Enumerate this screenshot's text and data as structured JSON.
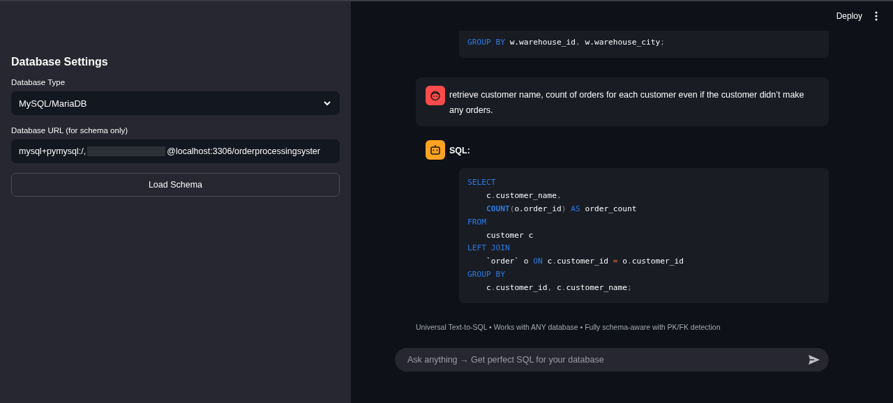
{
  "sidebar": {
    "title": "Database Settings",
    "db_type": {
      "label": "Database Type",
      "value": "MySQL/MariaDB"
    },
    "db_url": {
      "label": "Database URL (for schema only)",
      "value_before": "mysql+pymysql:/,",
      "redacted": true,
      "value_after": "@localhost:3306/orderprocessingsyster"
    },
    "load_button": "Load Schema"
  },
  "header": {
    "deploy": "Deploy"
  },
  "messages": [
    {
      "kind": "continuation",
      "code": [
        [
          {
            "kind": "kw",
            "text": "GROUP BY"
          },
          {
            "kind": "plain",
            "text": " w.warehouse_id"
          },
          {
            "kind": "punct",
            "text": ","
          },
          {
            "kind": "plain",
            "text": " w.warehouse_city"
          },
          {
            "kind": "punct",
            "text": ";"
          }
        ]
      ]
    },
    {
      "kind": "user",
      "text": "retrieve customer name, count of orders for each customer even if the customer didn’t make any orders."
    },
    {
      "kind": "assistant",
      "text": "SQL:",
      "code": [
        [
          {
            "kind": "kw",
            "text": "SELECT"
          }
        ],
        [
          {
            "kind": "plain",
            "text": "    c"
          },
          {
            "kind": "punct",
            "text": "."
          },
          {
            "kind": "plain",
            "text": "customer_name"
          },
          {
            "kind": "punct",
            "text": ","
          }
        ],
        [
          {
            "kind": "fn",
            "text": "    COUNT"
          },
          {
            "kind": "punct",
            "text": "("
          },
          {
            "kind": "plain",
            "text": "o.order_id"
          },
          {
            "kind": "punct",
            "text": ")"
          },
          {
            "kind": "kw",
            "text": " AS"
          },
          {
            "kind": "plain",
            "text": " order_count"
          }
        ],
        [
          {
            "kind": "kw",
            "text": "FROM"
          }
        ],
        [
          {
            "kind": "plain",
            "text": "    customer c"
          }
        ],
        [
          {
            "kind": "kw",
            "text": "LEFT JOIN"
          }
        ],
        [
          {
            "kind": "plain",
            "text": "    `order` o "
          },
          {
            "kind": "kw",
            "text": "ON"
          },
          {
            "kind": "plain",
            "text": " c"
          },
          {
            "kind": "punct",
            "text": "."
          },
          {
            "kind": "plain",
            "text": "customer_id "
          },
          {
            "kind": "op",
            "text": "="
          },
          {
            "kind": "plain",
            "text": " o"
          },
          {
            "kind": "punct",
            "text": "."
          },
          {
            "kind": "plain",
            "text": "customer_id"
          }
        ],
        [
          {
            "kind": "kw",
            "text": "GROUP BY"
          }
        ],
        [
          {
            "kind": "plain",
            "text": "    c"
          },
          {
            "kind": "punct",
            "text": "."
          },
          {
            "kind": "plain",
            "text": "customer_id"
          },
          {
            "kind": "punct",
            "text": ","
          },
          {
            "kind": "plain",
            "text": " c"
          },
          {
            "kind": "punct",
            "text": "."
          },
          {
            "kind": "plain",
            "text": "customer_name"
          },
          {
            "kind": "punct",
            "text": ";"
          }
        ]
      ]
    }
  ],
  "footer": "Universal Text-to-SQL • Works with ANY database • Fully schema-aware with PK/FK detection",
  "chat_input": {
    "placeholder": "Ask anything → Get perfect SQL for your database"
  }
}
